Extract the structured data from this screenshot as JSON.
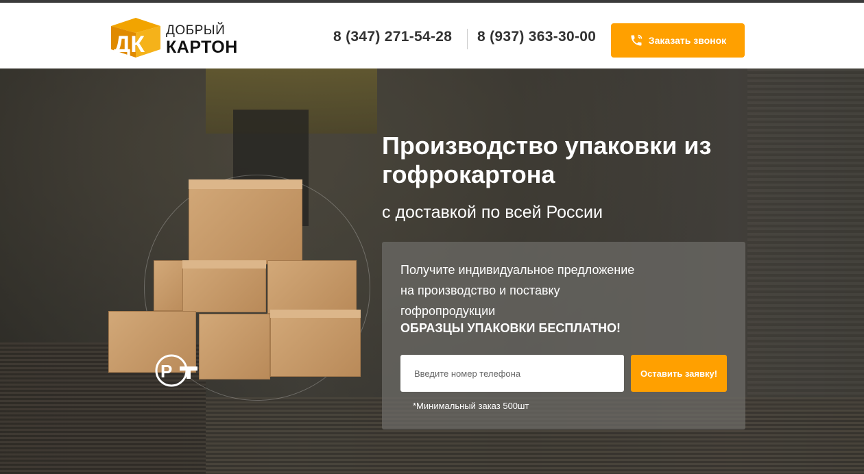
{
  "header": {
    "logo": {
      "line1": "ДОБРЫЙ",
      "line2": "КАРТОН",
      "mark_letters": "ДК"
    },
    "phones": [
      "8 (347) 271-54-28",
      "8 (937) 363-30-00"
    ],
    "call_button": {
      "label": "Заказать звонок",
      "icon": "phone-icon"
    }
  },
  "hero": {
    "title": "Производство упаковки из гофрокартона",
    "subtitle": "с доставкой по всей России",
    "panel": {
      "lines": [
        "Получите индивидуальное предложение",
        "на производство и поставку",
        "гофропродукции"
      ],
      "bold": "ОБРАЗЦЫ УПАКОВКИ БЕСПЛАТНО!",
      "input_placeholder": "Введите номер телефона",
      "submit_label": "Оставить заявку!",
      "min_order": "*Минимальный заказ 500шт"
    },
    "badge": "РСТ"
  },
  "colors": {
    "accent": "#ffa000",
    "header_bg": "#ffffff",
    "text_dark": "#333333"
  }
}
